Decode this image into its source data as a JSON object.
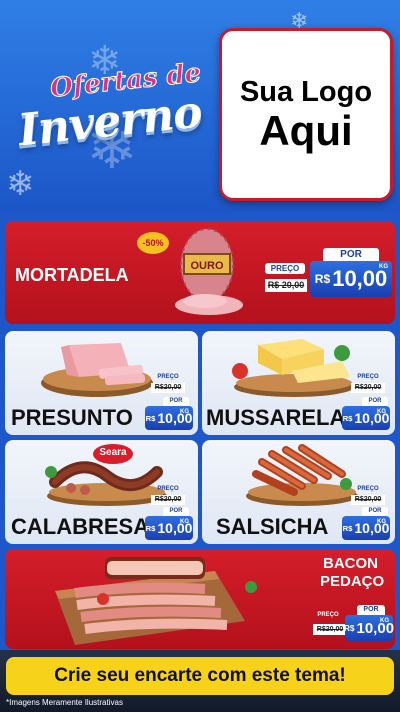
{
  "header": {
    "wordmark_line1": "Ofertas de",
    "wordmark_line2": "Inverno",
    "logo_line1": "Sua Logo",
    "logo_line2": "Aqui"
  },
  "mortadela": {
    "name": "MORTADELA",
    "discount": "-50%",
    "brand_label": "OURO",
    "preco_label": "PREÇO",
    "por_label": "POR",
    "old_price": "R$ 20,00",
    "currency": "R$",
    "new_price": "10,00",
    "unit": "KG"
  },
  "products": [
    {
      "name": "PRESUNTO",
      "preco_label": "PREÇO",
      "por_label": "POR",
      "old_price": "R$20,00",
      "currency": "R$",
      "new_price": "10,00",
      "unit": "KG"
    },
    {
      "name": "MUSSARELA",
      "preco_label": "PREÇO",
      "por_label": "POR",
      "old_price": "R$20,00",
      "currency": "R$",
      "new_price": "10,00",
      "unit": "KG"
    },
    {
      "name": "CALABRESA",
      "preco_label": "PREÇO",
      "por_label": "POR",
      "old_price": "R$20,00",
      "currency": "R$",
      "new_price": "10,00",
      "unit": "KG",
      "brand": "Seara"
    },
    {
      "name": "SALSICHA",
      "preco_label": "PREÇO",
      "por_label": "POR",
      "old_price": "R$20,00",
      "currency": "R$",
      "new_price": "10,00",
      "unit": "KG"
    }
  ],
  "bacon": {
    "name_line1": "BACON",
    "name_line2": "PEDAÇO",
    "preco_label": "PREÇO",
    "por_label": "POR",
    "old_price": "R$20,00",
    "currency": "R$",
    "new_price": "10,00",
    "unit": "KG"
  },
  "cta": {
    "text": "Crie seu encarte com este tema!"
  },
  "footnote": "*Imagens Meramente Ilustrativas",
  "colors": {
    "red": "#c81a25",
    "blue": "#1d57c9",
    "yellow": "#f6d21b"
  }
}
